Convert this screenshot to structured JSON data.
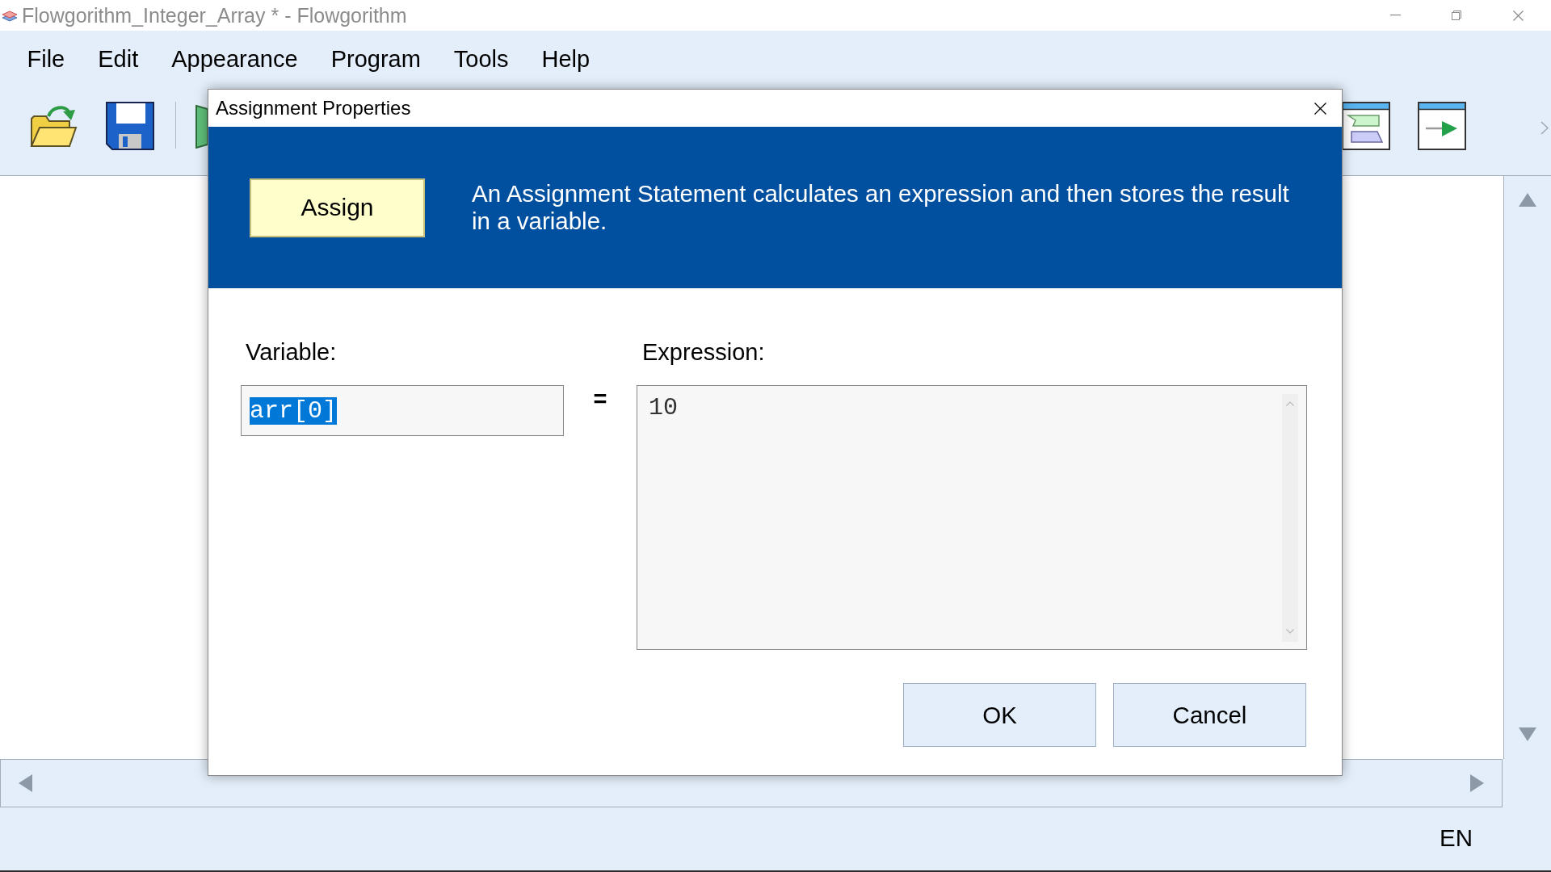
{
  "window": {
    "title": "Flowgorithm_Integer_Array * - Flowgorithm"
  },
  "menu": [
    "File",
    "Edit",
    "Appearance",
    "Program",
    "Tools",
    "Help"
  ],
  "dialog": {
    "title": "Assignment Properties",
    "badge": "Assign",
    "description": "An Assignment Statement calculates an expression and then stores the result in a variable.",
    "variable": {
      "label": "Variable:",
      "value": "arr[0]",
      "text_selected": true
    },
    "operator": "=",
    "expression": {
      "label": "Expression:",
      "value": "10"
    },
    "buttons": [
      {
        "label": "OK"
      },
      {
        "label": "Cancel"
      }
    ]
  },
  "status_bar": {
    "language": "EN"
  }
}
